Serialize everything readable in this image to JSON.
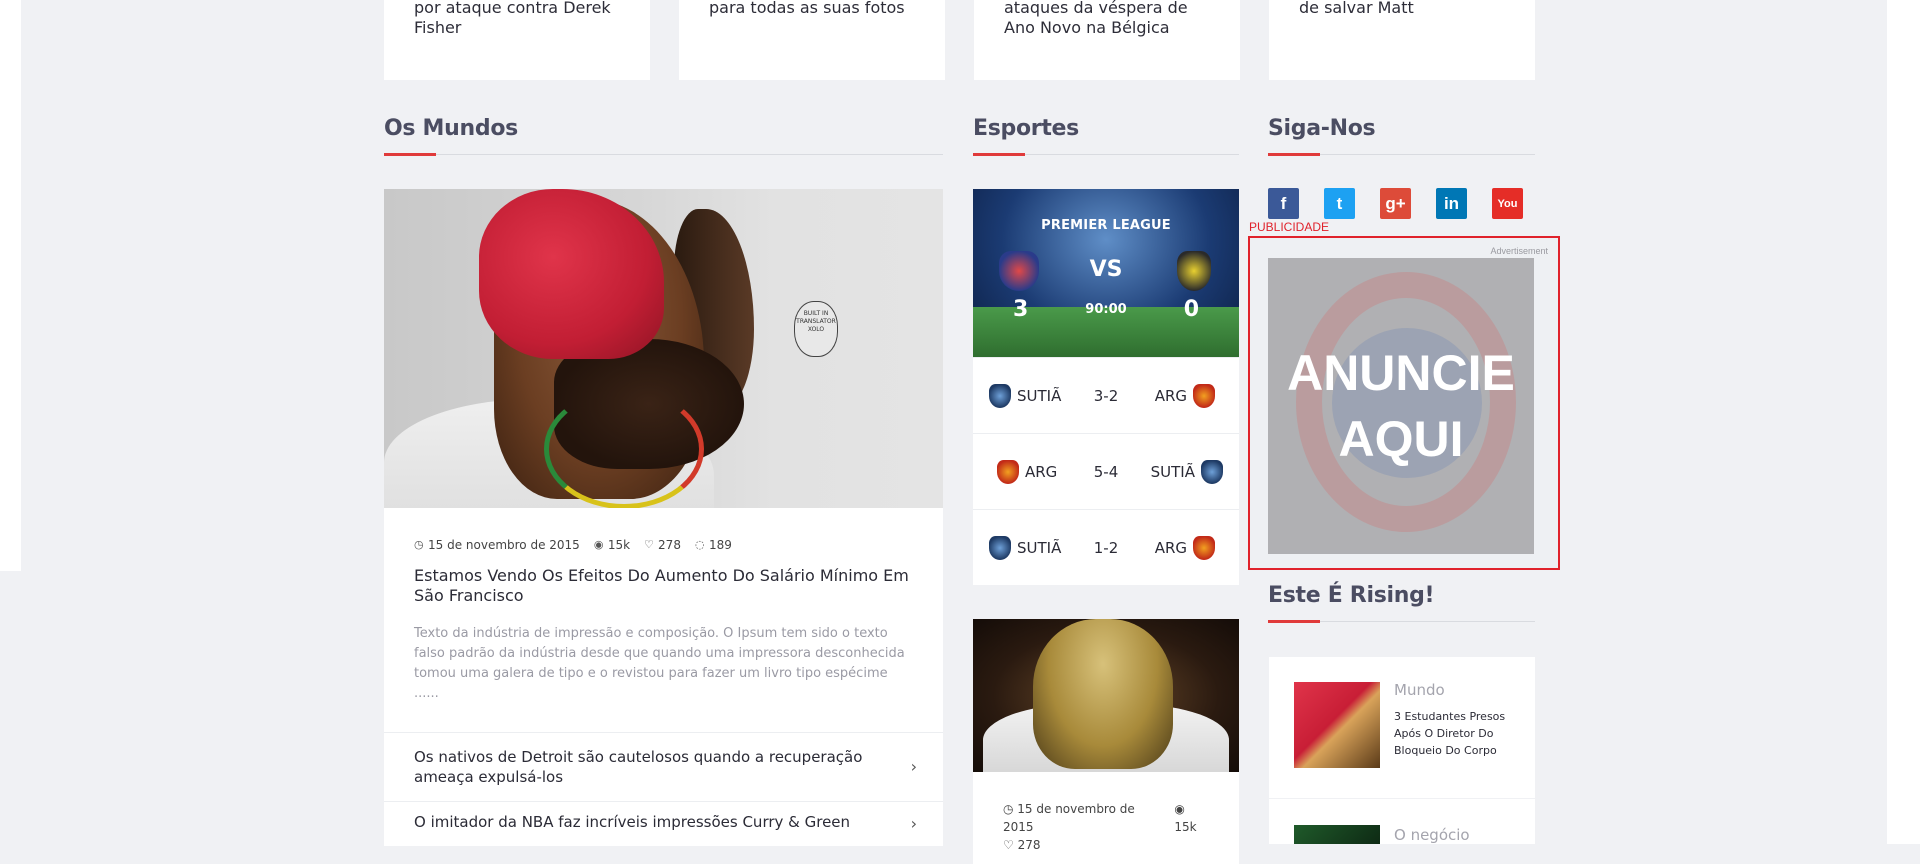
{
  "top_cards": [
    {
      "text": "por ataque contra Derek Fisher"
    },
    {
      "text": "para todas as suas fotos"
    },
    {
      "text": "ataques da véspera de Ano Novo na Bélgica"
    },
    {
      "text": "de salvar Matt"
    }
  ],
  "sections": {
    "mundos": "Os Mundos",
    "esportes": "Esportes",
    "siga": "Siga-Nos",
    "rising": "Este É Rising!"
  },
  "accent_color": "#e03a3a",
  "mundos": {
    "hero_bubble": "BUILT IN TRANSLATOR XOLO",
    "meta": {
      "date": "15 de novembro de 2015",
      "views": "15k",
      "likes": "278",
      "comments": "189"
    },
    "title": "Estamos Vendo Os Efeitos Do Aumento Do Salário Mínimo Em São Francisco",
    "excerpt": "Texto da indústria de impressão e composição. O Ipsum tem sido o texto falso padrão da indústria desde que quando uma impressora desconhecida tomou uma galera de tipo e o revistou para fazer um livro tipo espécime ......",
    "links": [
      "Os nativos de Detroit são cautelosos quando a recuperação ameaça expulsá-los",
      "O imitador da NBA faz incríveis impressões Curry & Green"
    ]
  },
  "esportes": {
    "match": {
      "league": "PREMIER LEAGUE",
      "vs": "VS",
      "home_score": "3",
      "away_score": "0",
      "time": "90:00"
    },
    "results": [
      {
        "home": "SUTIÃ",
        "score": "3-2",
        "away": "ARG",
        "home_badge": "blue",
        "away_badge": "red"
      },
      {
        "home": "ARG",
        "score": "5-4",
        "away": "SUTIÃ",
        "home_badge": "red",
        "away_badge": "blue"
      },
      {
        "home": "SUTIÃ",
        "score": "1-2",
        "away": "ARG",
        "home_badge": "blue",
        "away_badge": "red"
      }
    ],
    "meta": {
      "date": "15 de novembro de 2015",
      "views": "15k",
      "likes": "278"
    }
  },
  "social": [
    {
      "name": "facebook",
      "glyph": "f",
      "color": "#3b5998"
    },
    {
      "name": "twitter",
      "glyph": "t",
      "color": "#1da1f2"
    },
    {
      "name": "google-plus",
      "glyph": "g+",
      "color": "#dd4b39"
    },
    {
      "name": "linkedin",
      "glyph": "in",
      "color": "#0077b5"
    },
    {
      "name": "youtube",
      "glyph": "You",
      "color": "#e52d27"
    }
  ],
  "ad": {
    "label": "PUBLICIDADE",
    "advertisement": "Advertisement",
    "line1": "ANUNCIE",
    "line2": "AQUI"
  },
  "rising": [
    {
      "category": "Mundo",
      "title": "3 Estudantes Presos Após O Diretor Do Bloqueio Do Corpo"
    },
    {
      "category": "O negócio",
      "title": ""
    }
  ]
}
